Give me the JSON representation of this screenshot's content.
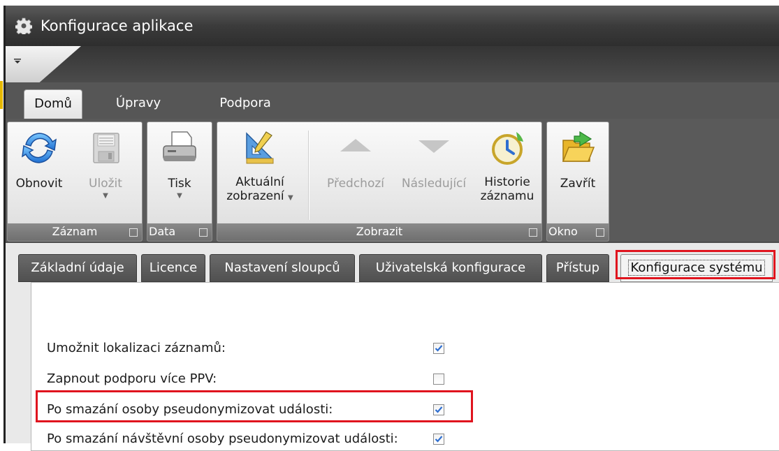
{
  "window": {
    "title": "Konfigurace aplikace"
  },
  "ribbon": {
    "tabs": [
      {
        "label": "Domů",
        "active": true
      },
      {
        "label": "Úpravy",
        "active": false
      },
      {
        "label": "Podpora",
        "active": false
      }
    ],
    "groups": {
      "zaznam": {
        "label": "Záznam",
        "buttons": [
          {
            "label": "Obnovit",
            "icon": "refresh-icon",
            "enabled": true
          },
          {
            "label": "Uložit",
            "icon": "save-icon",
            "enabled": false
          }
        ]
      },
      "data": {
        "label": "Data",
        "buttons": [
          {
            "label": "Tisk",
            "icon": "printer-icon",
            "enabled": true
          }
        ]
      },
      "zobrazit": {
        "label": "Zobrazit",
        "buttons": [
          {
            "label_line1": "Aktuální",
            "label_line2": "zobrazení",
            "icon": "design-icon",
            "enabled": true
          },
          {
            "label": "Předchozí",
            "icon": "arrow-up-icon",
            "enabled": false
          },
          {
            "label": "Následující",
            "icon": "arrow-down-icon",
            "enabled": false
          },
          {
            "label_line1": "Historie",
            "label_line2": "záznamu",
            "icon": "clock-history-icon",
            "enabled": true
          }
        ]
      },
      "okno": {
        "label": "Okno",
        "buttons": [
          {
            "label": "Zavřít",
            "icon": "exit-folder-icon",
            "enabled": true
          }
        ]
      }
    }
  },
  "page_tabs": [
    {
      "label": "Základní údaje",
      "active": false
    },
    {
      "label": "Licence",
      "active": false
    },
    {
      "label": "Nastavení sloupců",
      "active": false
    },
    {
      "label": "Uživatelská konfigurace",
      "active": false
    },
    {
      "label": "Přístup",
      "active": false
    },
    {
      "label": "Konfigurace systému",
      "active": true
    }
  ],
  "settings": [
    {
      "label": "Umožnit lokalizaci záznamů:",
      "checked": true
    },
    {
      "label": "Zapnout podporu více PPV:",
      "checked": false
    },
    {
      "label": "Po smazání osoby pseudonymizovat události:",
      "checked": true
    },
    {
      "label": "Po smazání návštěvní osoby pseudonymizovat události:",
      "checked": true
    }
  ],
  "colors": {
    "highlight": "#e0141e",
    "accent": "#2f6fd0"
  }
}
